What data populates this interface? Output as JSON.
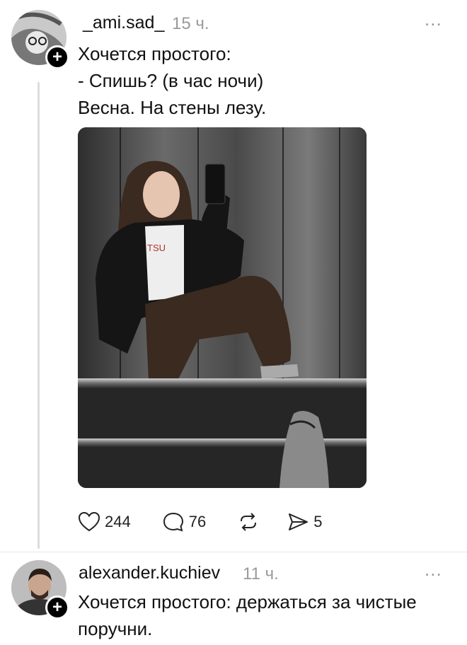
{
  "post1": {
    "username": "_ami.sad_",
    "time": "15 ч.",
    "more": "...",
    "text": "Хочется простого:\n- Спишь? (в час ночи)\nВесна. На стены лезу.",
    "likes": "244",
    "comments": "76",
    "shares": "5"
  },
  "post2": {
    "username": "alexander.kuchiev",
    "time": "11 ч.",
    "more": "...",
    "text": "Хочется простого: держаться за чистые\nпоручни."
  }
}
